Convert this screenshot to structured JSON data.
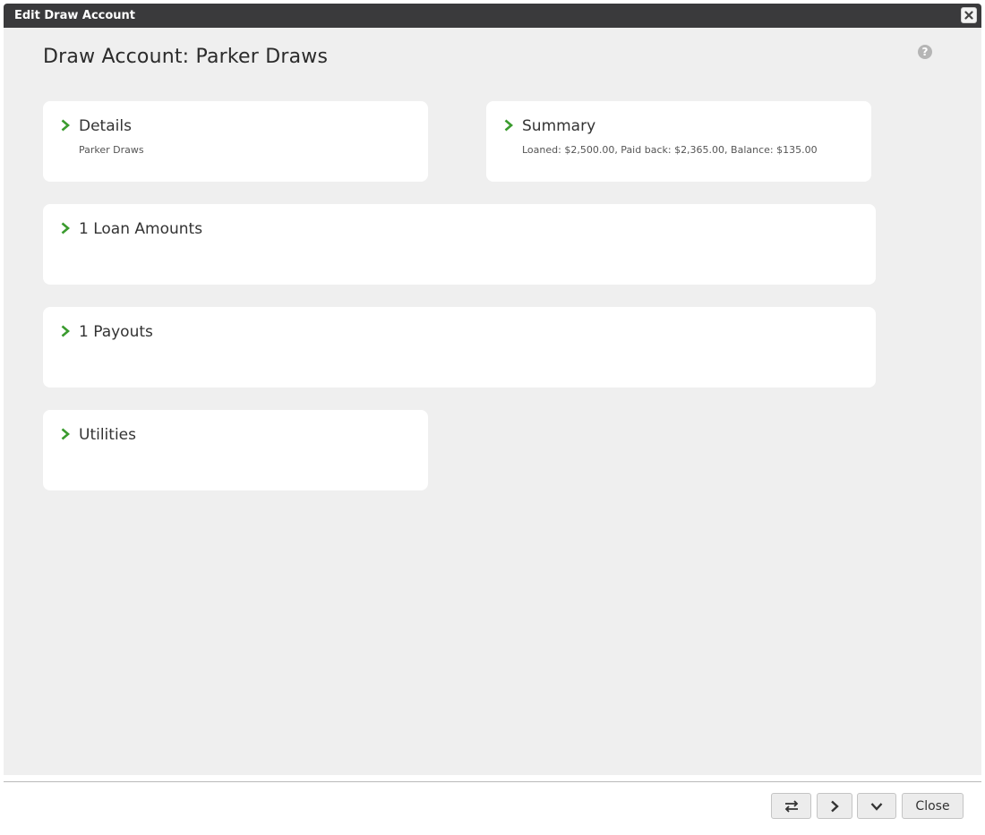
{
  "window": {
    "title": "Edit Draw Account"
  },
  "page": {
    "title": "Draw Account: Parker Draws"
  },
  "panels": {
    "details": {
      "title": "Details",
      "subtitle": "Parker Draws"
    },
    "summary": {
      "title": "Summary",
      "subtitle": "Loaned: $2,500.00, Paid back: $2,365.00, Balance: $135.00"
    },
    "loan_amounts": {
      "title": "1 Loan Amounts"
    },
    "payouts": {
      "title": "1 Payouts"
    },
    "utilities": {
      "title": "Utilities"
    }
  },
  "footer": {
    "close_label": "Close"
  },
  "icons": {
    "window_close": "close-icon",
    "help": "help-icon",
    "expand": "chevron-right-icon",
    "swap": "swap-arrows-icon",
    "next": "chevron-right-icon",
    "down": "chevron-down-icon"
  },
  "colors": {
    "titlebar": "#3a3a3c",
    "background": "#efefef",
    "panel": "#ffffff",
    "accent_chevron": "#3a9b2e"
  }
}
